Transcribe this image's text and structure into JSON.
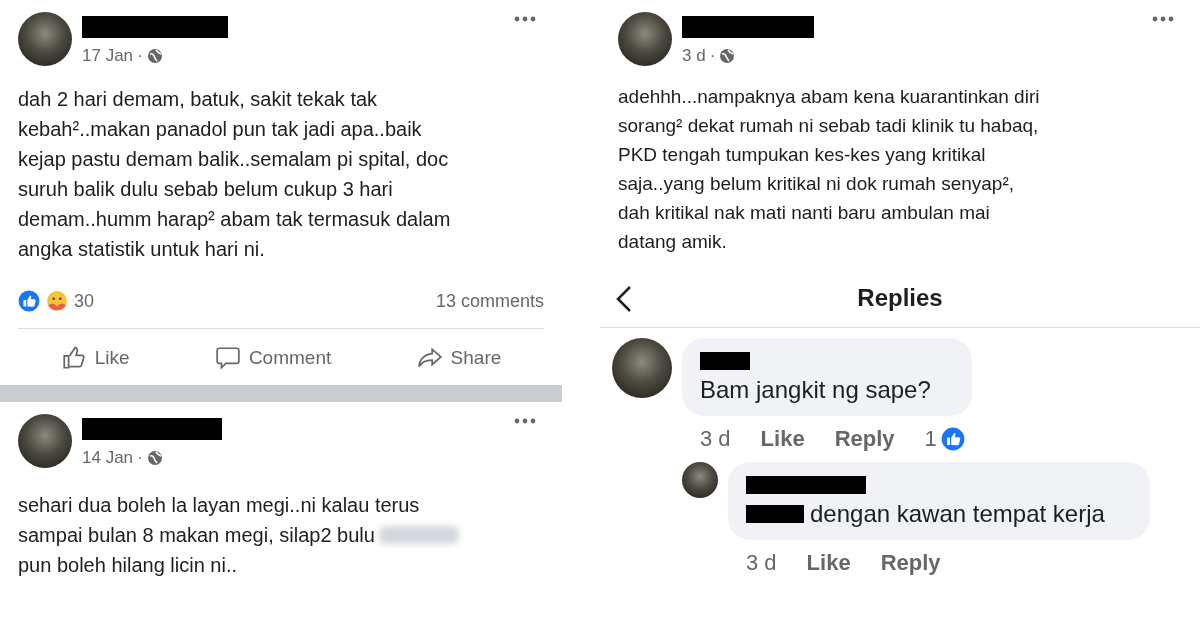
{
  "left_feed": {
    "posts": [
      {
        "date": "17 Jan",
        "separator": "·",
        "lines": [
          {
            "text": "dah 2 hari demam, batuk, sakit tekak tak",
            "blurred_tail": false
          },
          {
            "text": "kebah²..makan panadol pun tak jadi apa..baik",
            "blurred_tail": false
          },
          {
            "text": "kejap pastu demam balik..semalam pi spital, doc",
            "blurred_tail": false
          },
          {
            "text": "suruh balik dulu sebab belum cukup 3 hari",
            "blurred_tail": false
          },
          {
            "text": "demam..humm harap² abam tak termasuk dalam",
            "blurred_tail": false
          },
          {
            "text": "angka statistik untuk hari ni.",
            "blurred_tail": false
          }
        ],
        "reaction_count": "30",
        "comment_count": "13 comments",
        "actions": [
          "Like",
          "Comment",
          "Share"
        ]
      },
      {
        "date": "14 Jan",
        "separator": "·",
        "lines": [
          {
            "text": "sehari dua boleh la layan megi..ni kalau terus",
            "blurred_tail": false
          },
          {
            "text": "sampai bulan 8 makan megi, silap2 bulu",
            "blurred_tail": true
          },
          {
            "text": "pun boleh hilang licin ni..",
            "blurred_tail": false
          }
        ]
      }
    ]
  },
  "right_thread": {
    "post": {
      "date": "3 d",
      "separator": "·",
      "lines": [
        {
          "text": "adehhh...nampaknya abam kena kuarantinkan diri",
          "blurred_tail": false
        },
        {
          "text": "sorang² dekat rumah ni sebab tadi klinik tu habaq,",
          "blurred_tail": false
        },
        {
          "text": "PKD tengah tumpukan kes-kes yang kritikal",
          "blurred_tail": false
        },
        {
          "text": "saja..yang belum kritikal ni dok rumah senyap²,",
          "blurred_tail": false
        },
        {
          "text": "dah kritikal nak mati nanti baru ambulan mai",
          "blurred_tail": false
        },
        {
          "text": "datang amik.",
          "blurred_tail": false
        }
      ]
    },
    "replies_title": "Replies",
    "comments": [
      {
        "kind": "comment",
        "text": "Bam jangkit ng sape?",
        "time": "3 d",
        "like": "Like",
        "reply": "Reply",
        "likes": "1"
      },
      {
        "kind": "reply",
        "text": "dengan kawan tempat kerja",
        "time": "3 d",
        "like": "Like",
        "reply": "Reply"
      }
    ]
  }
}
